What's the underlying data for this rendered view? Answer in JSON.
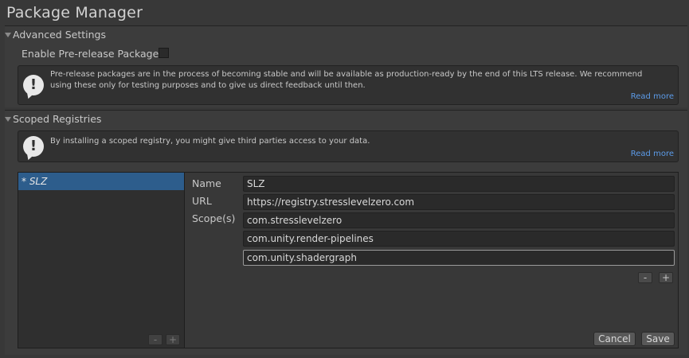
{
  "window": {
    "title": "Package Manager"
  },
  "advanced": {
    "title": "Advanced Settings",
    "prerelease_label": "Enable Pre-release Packages",
    "prerelease_checked": false,
    "help_text": "Pre-release packages are in the process of becoming stable and will be available as production-ready by the end of this LTS release. We recommend using these only for testing purposes and to give us direct feedback until then.",
    "read_more": "Read more"
  },
  "scoped": {
    "title": "Scoped Registries",
    "help_text": "By installing a scoped registry, you might give third parties access to your data.",
    "read_more": "Read more",
    "registries": [
      "* SLZ"
    ],
    "list_remove": "-",
    "list_add": "+",
    "labels": {
      "name": "Name",
      "url": "URL",
      "scopes": "Scope(s)"
    },
    "values": {
      "name": "SLZ",
      "url": "https://registry.stresslevelzero.com",
      "scopes": [
        "com.stresslevelzero",
        "com.unity.render-pipelines",
        "com.unity.shadergraph"
      ]
    },
    "scope_remove": "-",
    "scope_add": "+",
    "cancel": "Cancel",
    "save": "Save"
  },
  "icons": [
    "foldout-arrow-icon",
    "warning-icon"
  ]
}
